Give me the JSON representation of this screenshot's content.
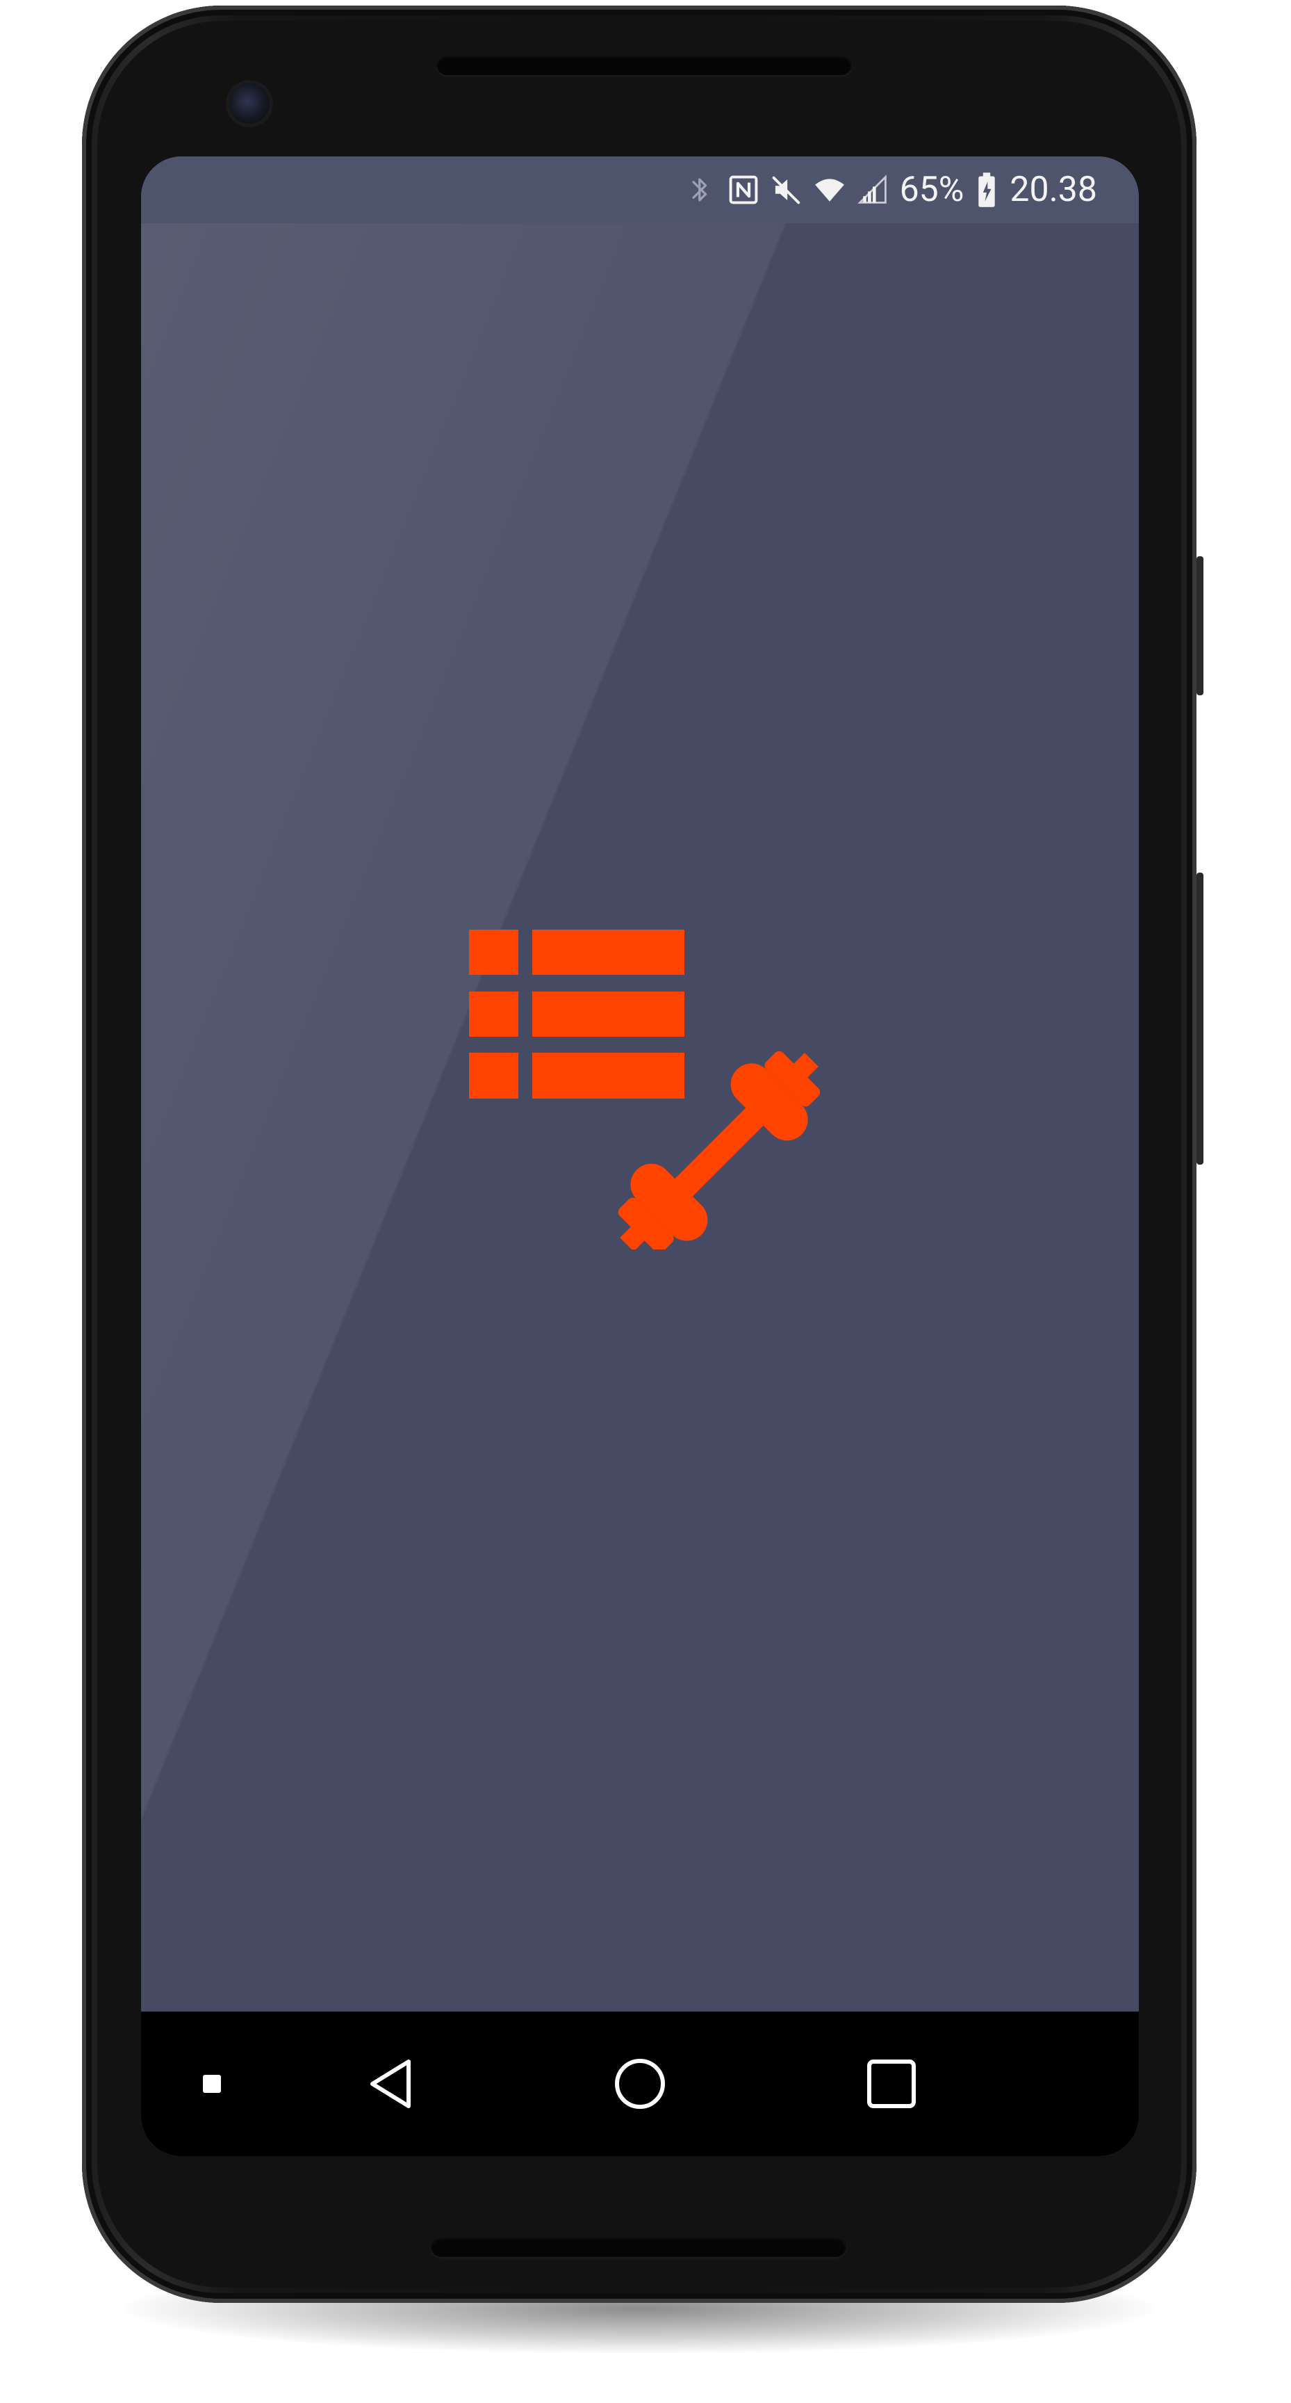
{
  "device": {
    "frame_color": "#121212",
    "screen_bg": "#464b63",
    "status_bar_bg": "#4f546d",
    "nav_bar_bg": "#000000"
  },
  "status_bar": {
    "icons": [
      "bluetooth-icon",
      "nfc-icon",
      "volume-muted-icon",
      "wifi-icon",
      "cell-signal-icon",
      "battery-charging-icon"
    ],
    "battery_percent": "65%",
    "time": "20.38"
  },
  "splash": {
    "logo_icon": "workout-list-dumbbell-icon",
    "accent_color": "#ff4300"
  },
  "nav_bar": {
    "items": [
      "app-indicator-icon",
      "back-icon",
      "home-icon",
      "recents-icon"
    ]
  }
}
